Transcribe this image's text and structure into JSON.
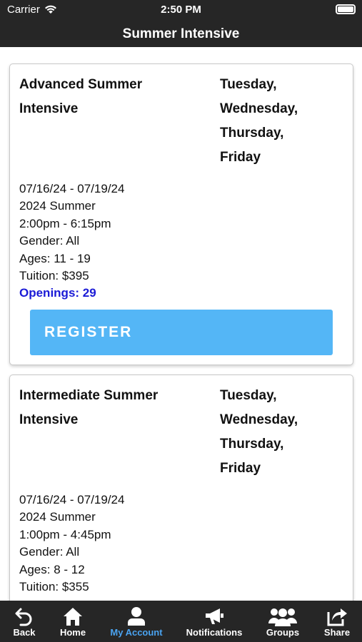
{
  "status": {
    "carrier": "Carrier",
    "time": "2:50 PM"
  },
  "header": {
    "title": "Summer Intensive"
  },
  "classes": [
    {
      "name": "Advanced Summer Intensive",
      "days": [
        "Tuesday,",
        "Wednesday,",
        "Thursday,",
        "Friday"
      ],
      "dates": "07/16/24 - 07/19/24",
      "session": "2024 Summer",
      "time": "2:00pm - 6:15pm",
      "gender": "Gender: All",
      "ages": "Ages: 11 - 19",
      "tuition": "Tuition: $395",
      "openings": "Openings: 29",
      "register_label": "REGISTER"
    },
    {
      "name": "Intermediate Summer Intensive",
      "days": [
        "Tuesday,",
        "Wednesday,",
        "Thursday,",
        "Friday"
      ],
      "dates": "07/16/24 - 07/19/24",
      "session": "2024 Summer",
      "time": "1:00pm - 4:45pm",
      "gender": "Gender: All",
      "ages": "Ages: 8 - 12",
      "tuition": "Tuition: $355"
    }
  ],
  "tabs": [
    {
      "label": "Back",
      "icon": "back-arrow-icon"
    },
    {
      "label": "Home",
      "icon": "home-icon"
    },
    {
      "label": "My Account",
      "icon": "user-icon",
      "active": true
    },
    {
      "label": "Notifications",
      "icon": "megaphone-icon"
    },
    {
      "label": "Groups",
      "icon": "groups-icon"
    },
    {
      "label": "Share",
      "icon": "share-icon"
    }
  ],
  "colors": {
    "bar": "#262626",
    "register": "#54b6f6",
    "openings": "#1a1ad6",
    "active_tab": "#4aa3f0"
  }
}
